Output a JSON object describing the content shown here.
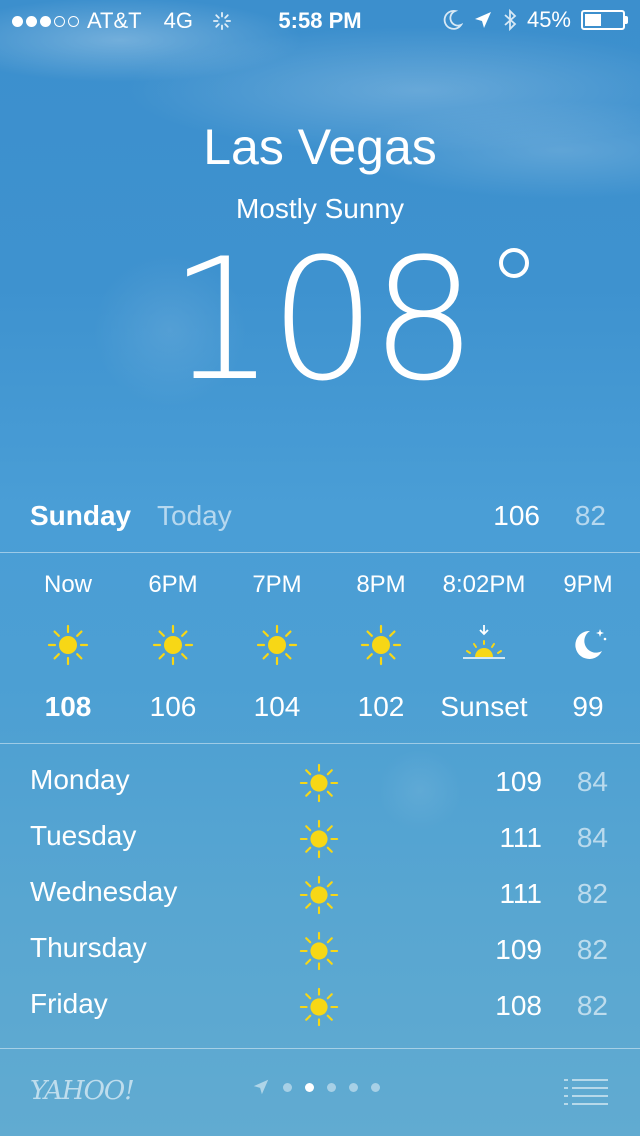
{
  "status_bar": {
    "carrier": "AT&T",
    "network": "4G",
    "time": "5:58 PM",
    "battery": "45%",
    "battery_level": 0.45,
    "signal_bars_filled": 3,
    "signal_bars_total": 5
  },
  "header": {
    "city": "Las Vegas",
    "condition": "Mostly Sunny",
    "temperature": "108"
  },
  "today": {
    "day": "Sunday",
    "label": "Today",
    "high": "106",
    "low": "82"
  },
  "hourly": [
    {
      "time": "Now",
      "icon": "sun-icon",
      "temp": "108"
    },
    {
      "time": "6PM",
      "icon": "sun-icon",
      "temp": "106"
    },
    {
      "time": "7PM",
      "icon": "sun-icon",
      "temp": "104"
    },
    {
      "time": "8PM",
      "icon": "sun-icon",
      "temp": "102"
    },
    {
      "time": "8:02PM",
      "icon": "sunset-icon",
      "temp": "Sunset"
    },
    {
      "time": "9PM",
      "icon": "moon-icon",
      "temp": "99"
    }
  ],
  "daily": [
    {
      "day": "Monday",
      "icon": "sun-icon",
      "high": "109",
      "low": "84"
    },
    {
      "day": "Tuesday",
      "icon": "sun-icon",
      "high": "111",
      "low": "84"
    },
    {
      "day": "Wednesday",
      "icon": "sun-icon",
      "high": "111",
      "low": "82"
    },
    {
      "day": "Thursday",
      "icon": "sun-icon",
      "high": "109",
      "low": "82"
    },
    {
      "day": "Friday",
      "icon": "sun-icon",
      "high": "108",
      "low": "82"
    }
  ],
  "footer": {
    "provider": "YAHOO!",
    "page_count": 5,
    "active_page": 1
  },
  "colors": {
    "sun": "#f7d716",
    "background_top": "#3c8fcd",
    "background_bottom": "#61abd1"
  }
}
